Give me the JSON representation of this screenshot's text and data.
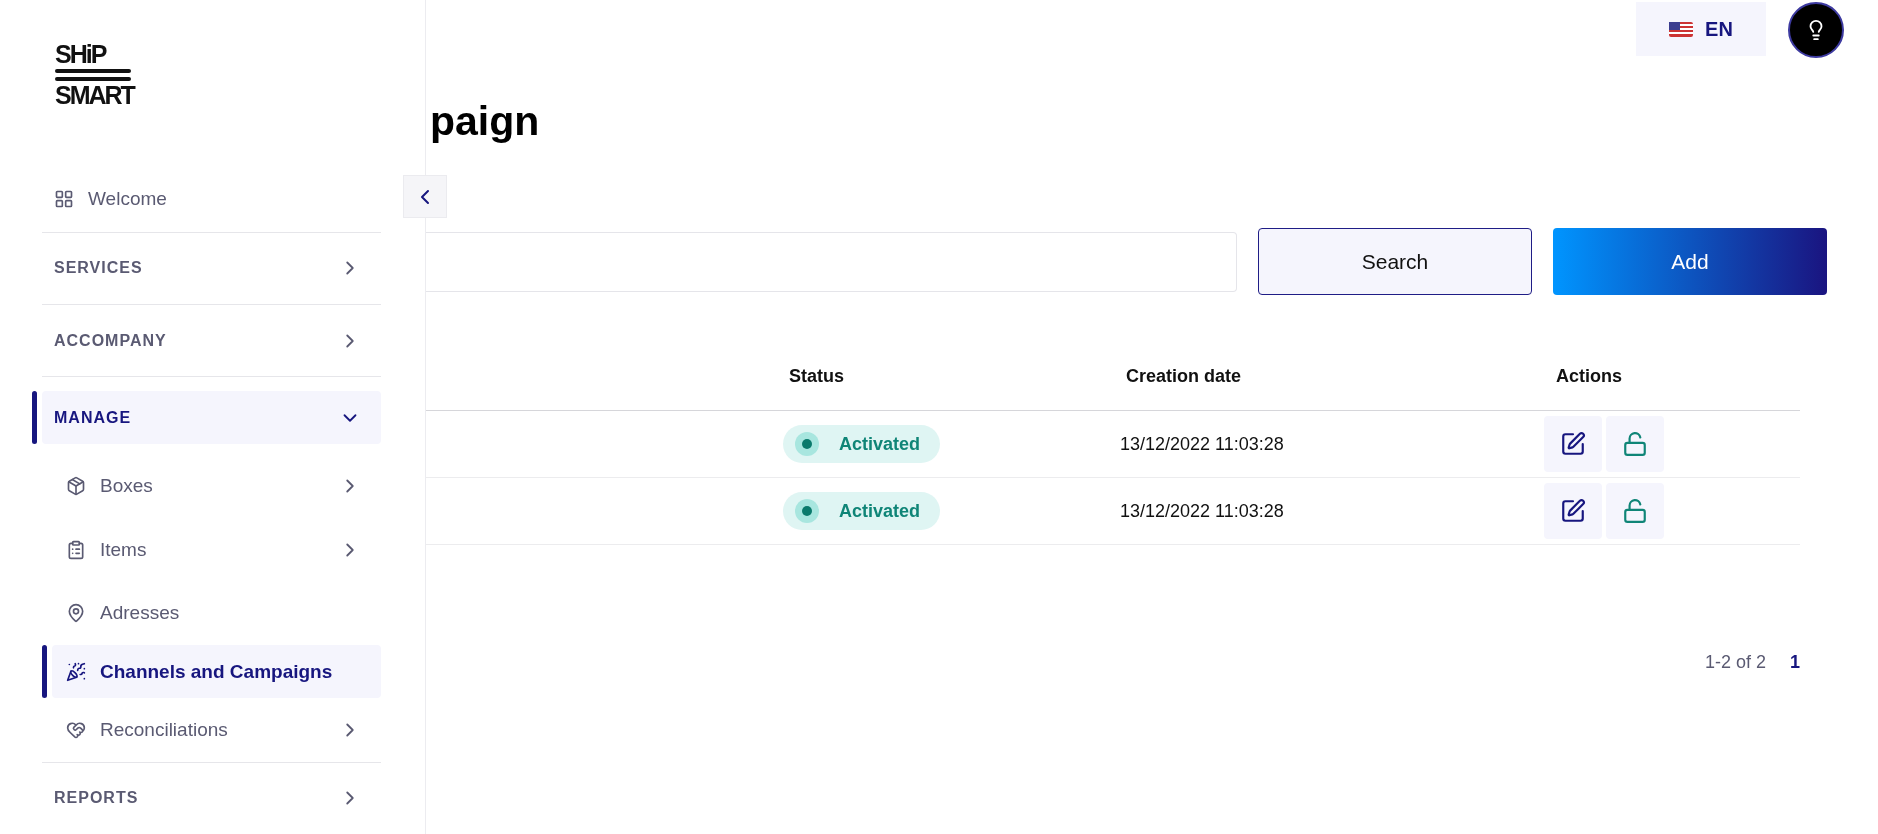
{
  "sidebar": {
    "logo": {
      "line_1": "SHiP",
      "line_2": "SMART"
    },
    "items": [
      {
        "kind": "link",
        "label": "Welcome",
        "selected": false
      },
      {
        "kind": "section",
        "label": "SERVICES",
        "expanded": false,
        "selected": false
      },
      {
        "kind": "section",
        "label": "ACCOMPANY",
        "expanded": false,
        "selected": false
      },
      {
        "kind": "section",
        "label": "MANAGE",
        "expanded": true,
        "selected": true,
        "children": [
          {
            "label": "Boxes",
            "expandable": true,
            "selected": false
          },
          {
            "label": "Items",
            "expandable": true,
            "selected": false
          },
          {
            "label": "Adresses",
            "expandable": false,
            "selected": false
          },
          {
            "label": "Channels and Campaigns",
            "expandable": false,
            "selected": true
          },
          {
            "label": "Reconciliations",
            "expandable": true,
            "selected": false
          }
        ]
      },
      {
        "kind": "section",
        "label": "REPORTS",
        "expanded": false,
        "selected": false
      }
    ]
  },
  "topbar": {
    "language": "EN"
  },
  "page_title": "paign",
  "search": {
    "button": "Search"
  },
  "add_button": "Add",
  "table": {
    "columns": [
      "Status",
      "Creation date",
      "Actions"
    ],
    "rows": [
      {
        "status": {
          "label": "Activated",
          "kind": "activated"
        },
        "creation_date": "13/12/2022 11:03:28"
      },
      {
        "status": {
          "label": "Activated",
          "kind": "activated"
        },
        "creation_date": "13/12/2022 11:03:28"
      }
    ]
  },
  "pagination": {
    "range": "1-2 of 2",
    "pages": [
      {
        "label": "1",
        "selected": true
      }
    ]
  }
}
